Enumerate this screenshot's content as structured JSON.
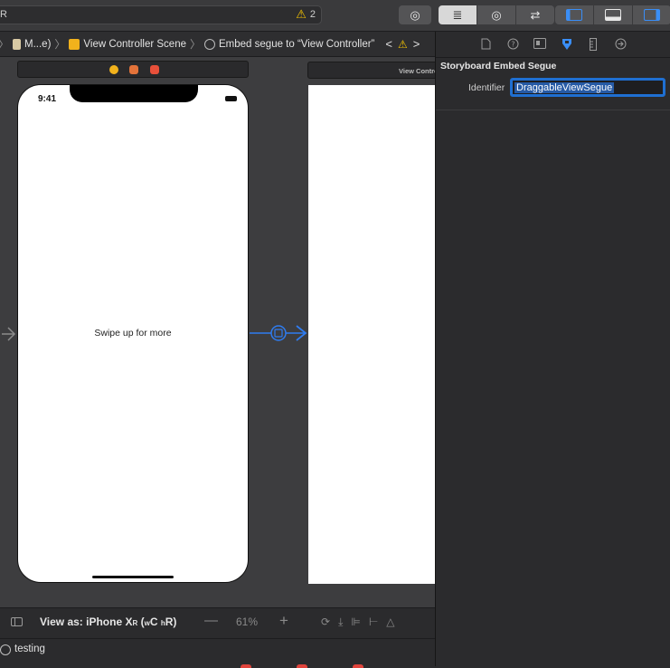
{
  "toolbar": {
    "activity_left": "R",
    "warning_count": "2",
    "segments": [
      "≣",
      "◎",
      "⇄"
    ],
    "panel_toggles": [
      "left-panel",
      "bottom-panel",
      "right-panel"
    ]
  },
  "jumpbar": {
    "items": [
      "M...e)",
      "View Controller Scene",
      "Embed segue to “View Controller”"
    ],
    "nav_back": "<",
    "nav_forward": ">"
  },
  "canvas": {
    "phone_time": "9:41",
    "swipe_text": "Swipe up for more",
    "second_scene_title": "View Controller"
  },
  "bottombar": {
    "view_as_label": "View as: iPhone X",
    "view_as_r": "R",
    "size_class_open": " (",
    "size_class_w": "w",
    "size_class_c": "C",
    "size_class_h": "h",
    "size_class_r": "R",
    "size_class_close": ")",
    "zoom_value": "61%",
    "zoom_minus": "—",
    "zoom_plus": "+"
  },
  "debug": {
    "target_label": "testing"
  },
  "inspector": {
    "section_title": "Storyboard Embed Segue",
    "identifier_label": "Identifier",
    "identifier_value": "DraggableViewSegue"
  },
  "colors": {
    "accent": "#3a8ef6",
    "warning": "#f5c400"
  }
}
